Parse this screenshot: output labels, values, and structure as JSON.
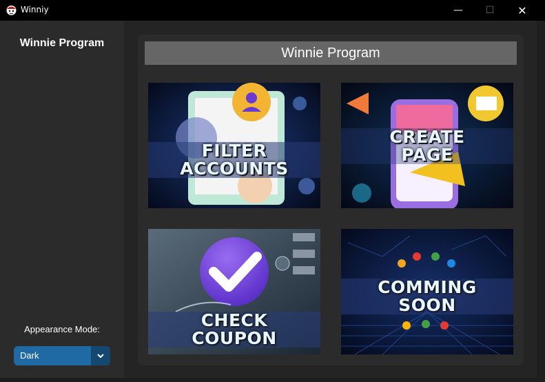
{
  "window": {
    "title": "Winniy",
    "minimize_glyph": "—",
    "maximize_glyph": "☐",
    "close_glyph": "✕"
  },
  "sidebar": {
    "title": "Winnie Program",
    "appearance_label": "Appearance Mode:",
    "appearance_value": "Dark"
  },
  "main": {
    "header": "Winnie Program",
    "tiles": [
      {
        "label_line1": "FILTER",
        "label_line2": "ACCOUNTS"
      },
      {
        "label_line1": "CREATE",
        "label_line2": "PAGE"
      },
      {
        "label_line1": "CHECK",
        "label_line2": "COUPON"
      },
      {
        "label_line1": "COMMING",
        "label_line2": "SOON"
      }
    ]
  },
  "colors": {
    "titlebar": "#000000",
    "sidebar": "#2b2b2b",
    "accent": "#1f6aa5",
    "header_bar": "#666666"
  },
  "icons": [
    "app-logo-icon",
    "minimize-icon",
    "maximize-icon",
    "close-icon",
    "chevron-down-icon"
  ]
}
